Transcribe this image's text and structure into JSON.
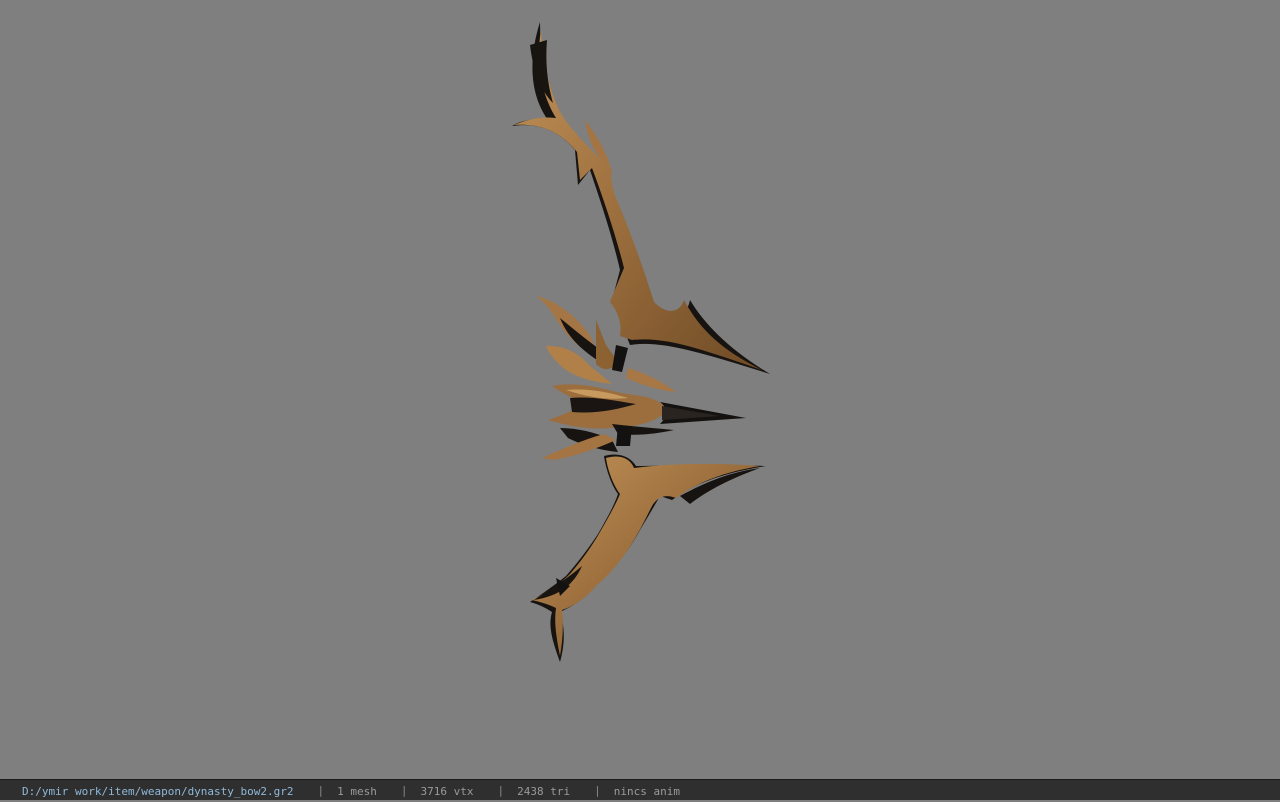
{
  "viewer": {
    "background_color": "#7f7f7f",
    "model_icon": "bow-model",
    "model_colors": {
      "bronze": "#9a6d3c",
      "bronze_light": "#b98a52",
      "shadow": "#141210"
    }
  },
  "status_bar": {
    "file_path": "D:/ymir work/item/weapon/dynasty_bow2.gr2",
    "separator": "|",
    "mesh_count": "1 mesh",
    "vertex_count": "3716 vtx",
    "triangle_count": "2438 tri",
    "animation": "nincs anim"
  }
}
